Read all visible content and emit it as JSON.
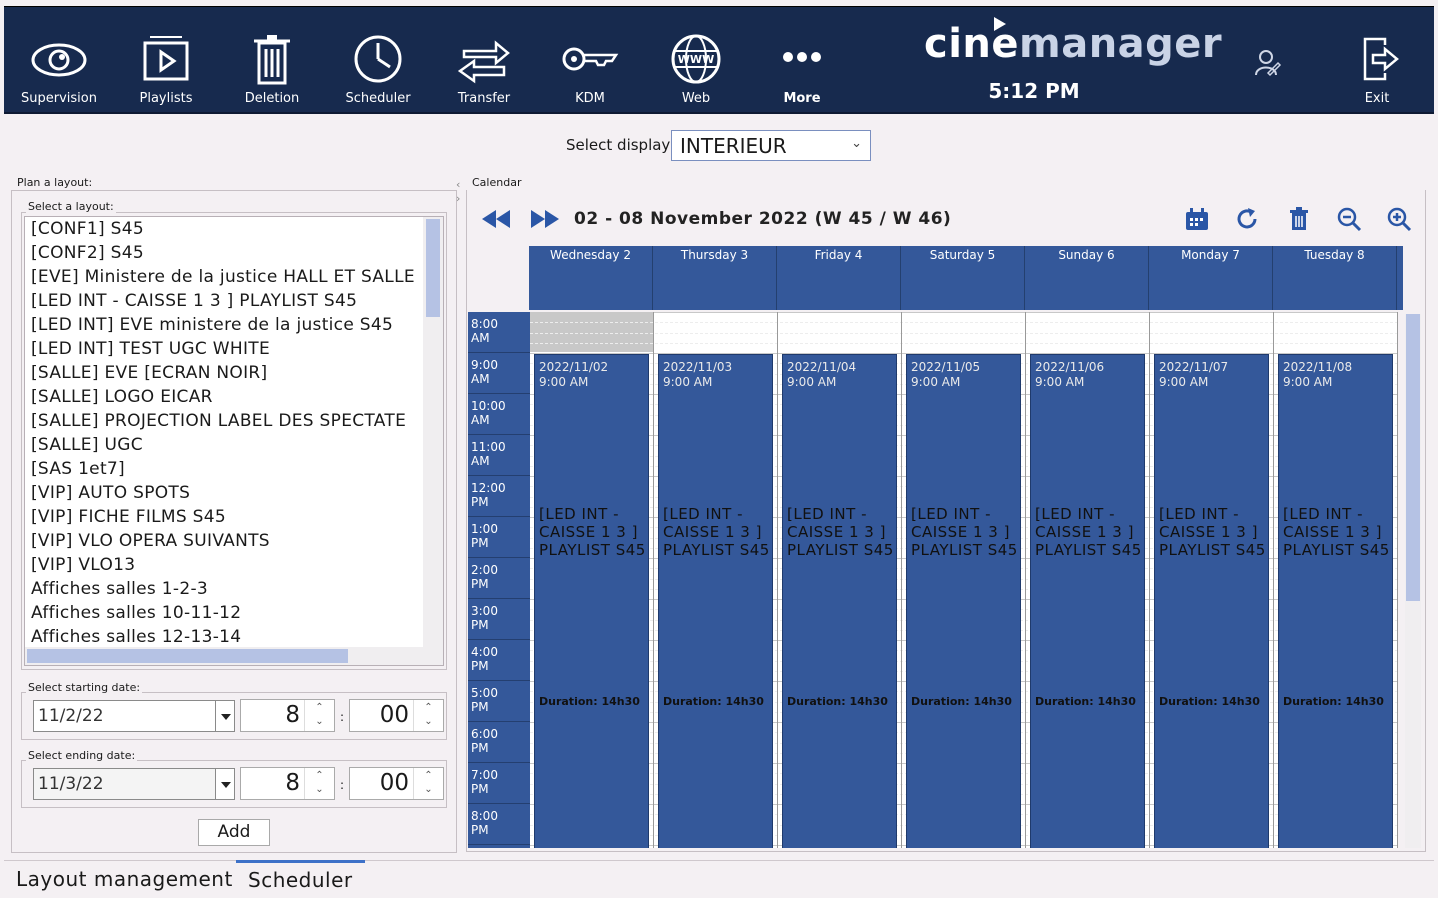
{
  "toolbar": {
    "items": [
      {
        "label": "Supervision",
        "icon": "eye-icon"
      },
      {
        "label": "Playlists",
        "icon": "playlist-icon"
      },
      {
        "label": "Deletion",
        "icon": "trash-icon"
      },
      {
        "label": "Scheduler",
        "icon": "clock-icon"
      },
      {
        "label": "Transfer",
        "icon": "transfer-arrows-icon"
      },
      {
        "label": "KDM",
        "icon": "key-icon"
      },
      {
        "label": "Web",
        "icon": "globe-icon"
      },
      {
        "label": "More",
        "icon": "more-dots-icon"
      }
    ],
    "exit_label": "Exit",
    "logo_part1": "cine",
    "logo_part2": "manager",
    "clock": "5:12 PM"
  },
  "display": {
    "label": "Select display:",
    "value": "INTERIEUR"
  },
  "plan": {
    "legend": "Plan a layout:",
    "select_legend": "Select a layout:",
    "layouts": [
      "[CONF1] S45",
      "[CONF2] S45",
      "[EVE] Ministere de la justice HALL ET SALLE",
      "[LED INT - CAISSE 1 3 ] PLAYLIST S45",
      "[LED INT] EVE ministere de la justice S45",
      "[LED INT] TEST UGC WHITE",
      "[SALLE] EVE [ECRAN NOIR]",
      "[SALLE] LOGO EICAR",
      "[SALLE] PROJECTION LABEL DES SPECTATE",
      "[SALLE] UGC",
      "[SAS 1et7]",
      "[VIP] AUTO SPOTS",
      "[VIP] FICHE FILMS S45",
      "[VIP] VLO OPERA SUIVANTS",
      "[VIP] VLO13",
      "Affiches salles 1-2-3",
      "Affiches salles 10-11-12",
      "Affiches salles 12-13-14"
    ],
    "start_legend": "Select starting date:",
    "start_date": "11/2/22",
    "start_hour": "8",
    "start_min": "00",
    "end_legend": "Select ending date:",
    "end_date": "11/3/22",
    "end_hour": "8",
    "end_min": "00",
    "colon": ":",
    "add_label": "Add"
  },
  "calendar": {
    "legend": "Calendar",
    "range": "02 - 08 November 2022 (W 45 / W 46)",
    "days": [
      "Wednesday 2",
      "Thursday 3",
      "Friday 4",
      "Saturday 5",
      "Sunday 6",
      "Monday 7",
      "Tuesday 8"
    ],
    "times": [
      [
        "8:00",
        "AM"
      ],
      [
        "9:00",
        "AM"
      ],
      [
        "10:00",
        "AM"
      ],
      [
        "11:00",
        "AM"
      ],
      [
        "12:00",
        "PM"
      ],
      [
        "1:00",
        "PM"
      ],
      [
        "2:00",
        "PM"
      ],
      [
        "3:00",
        "PM"
      ],
      [
        "4:00",
        "PM"
      ],
      [
        "5:00",
        "PM"
      ],
      [
        "6:00",
        "PM"
      ],
      [
        "7:00",
        "PM"
      ],
      [
        "8:00",
        "PM"
      ]
    ],
    "events": [
      {
        "date": "2022/11/02",
        "time": "9:00 AM",
        "title": "[LED INT - CAISSE 1 3 ] PLAYLIST S45",
        "duration": "Duration: 14h30"
      },
      {
        "date": "2022/11/03",
        "time": "9:00 AM",
        "title": "[LED INT - CAISSE 1 3 ] PLAYLIST S45",
        "duration": "Duration: 14h30"
      },
      {
        "date": "2022/11/04",
        "time": "9:00 AM",
        "title": "[LED INT - CAISSE 1 3 ] PLAYLIST S45",
        "duration": "Duration: 14h30"
      },
      {
        "date": "2022/11/05",
        "time": "9:00 AM",
        "title": "[LED INT - CAISSE 1 3 ] PLAYLIST S45",
        "duration": "Duration: 14h30"
      },
      {
        "date": "2022/11/06",
        "time": "9:00 AM",
        "title": "[LED INT - CAISSE 1 3 ] PLAYLIST S45",
        "duration": "Duration: 14h30"
      },
      {
        "date": "2022/11/07",
        "time": "9:00 AM",
        "title": "[LED INT - CAISSE 1 3 ] PLAYLIST S45",
        "duration": "Duration: 14h30"
      },
      {
        "date": "2022/11/08",
        "time": "9:00 AM",
        "title": "[LED INT - CAISSE 1 3 ] PLAYLIST S45",
        "duration": "Duration: 14h30"
      }
    ]
  },
  "tabs": [
    "Layout management",
    "Scheduler"
  ],
  "colors": {
    "topbar": "#172a4e",
    "event": "#34589a",
    "accent": "#2a56a6"
  }
}
